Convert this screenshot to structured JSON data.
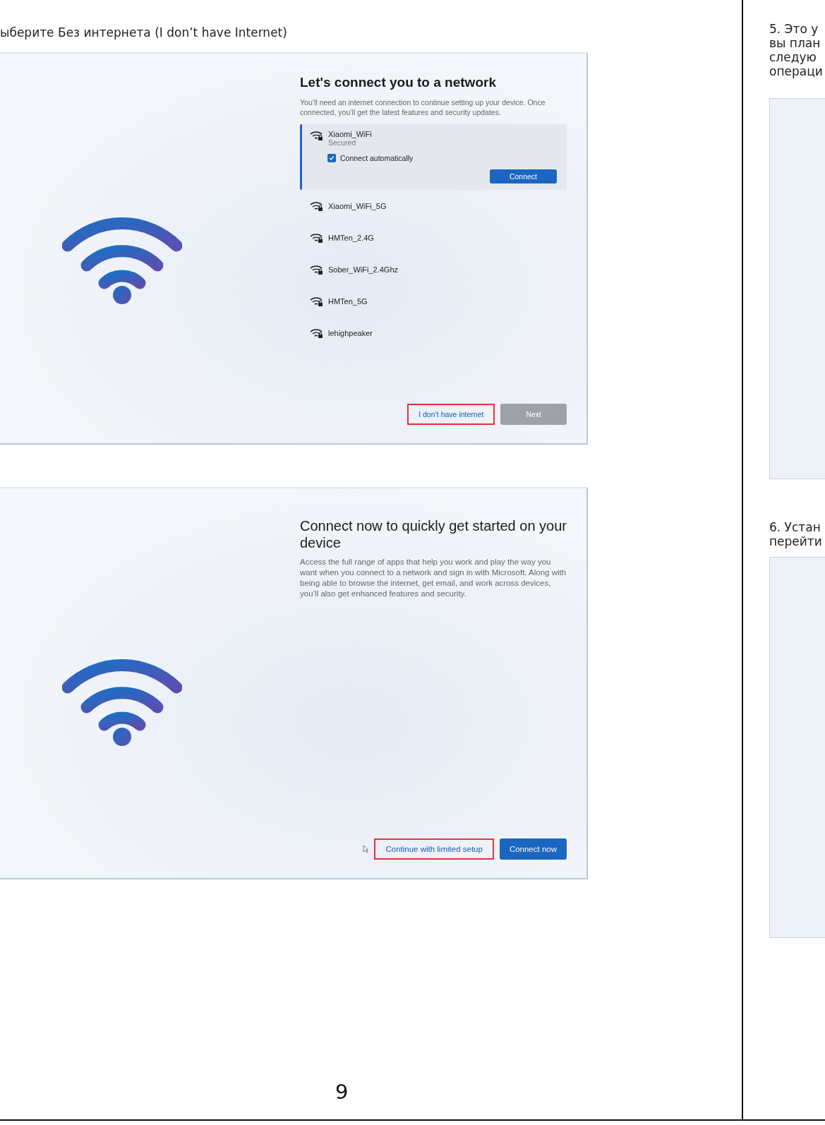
{
  "instruction": {
    "text": "ыберите Без интернета (I don’t have Internet)"
  },
  "screens": [
    {
      "kind": "network_list",
      "title": "Let's connect you to a network",
      "description": "You’ll need an internet connection to continue setting up your device. Once connected, you’ll get the latest features and security updates.",
      "networks": [
        {
          "name": "Xiaomi_WiFi",
          "selected": true,
          "status": "Secured",
          "connect_automatically": {
            "label": "Connect automatically",
            "checked": true
          },
          "connect_button": "Connect"
        },
        {
          "name": "Xiaomi_WiFi_5G",
          "selected": false
        },
        {
          "name": "HMTen_2.4G",
          "selected": false
        },
        {
          "name": "Sober_WiFi_2.4Ghz",
          "selected": false
        },
        {
          "name": "HMTen_5G",
          "selected": false
        },
        {
          "name": "lehighpeaker",
          "selected": false
        }
      ],
      "buttons": [
        {
          "label": "I don’t have internet",
          "kind": "link",
          "highlighted": true,
          "disabled": false
        },
        {
          "label": "Next",
          "kind": "primary",
          "highlighted": false,
          "disabled": true
        }
      ]
    },
    {
      "kind": "prompt",
      "title": "Connect now to quickly get started on your device",
      "description": "Access the full range of apps that help you work and play the way you want when you connect to a network and sign in with Microsoft. Along with being able to browse the internet, get email, and work across devices, you’ll also get enhanced features and security.",
      "buttons": [
        {
          "label": "Continue with limited setup",
          "kind": "link",
          "highlighted": true,
          "disabled": false
        },
        {
          "label": "Connect now",
          "kind": "primary",
          "highlighted": false,
          "disabled": false
        }
      ]
    }
  ],
  "page_number": "9",
  "side_column": {
    "step_5": [
      "5. Это у",
      "вы план",
      "следую",
      "операци"
    ],
    "step_6": [
      "6. Устан",
      "перейти"
    ]
  }
}
